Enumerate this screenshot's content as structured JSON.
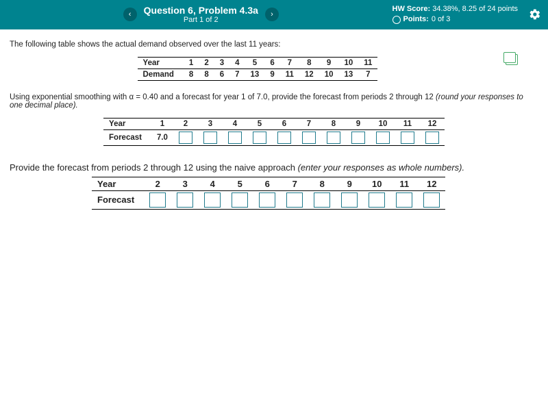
{
  "header": {
    "prev": "‹",
    "next": "›",
    "title": "Question 6, Problem 4.3a",
    "subtitle": "Part 1 of 2",
    "hw_label": "HW Score:",
    "hw_value": "34.38%, 8.25 of 24 points",
    "points_label": "Points:",
    "points_value": "0 of 3"
  },
  "intro": "The following table shows the actual demand observed over the last 11 years:",
  "table1": {
    "row1_label": "Year",
    "row2_label": "Demand",
    "years": [
      "1",
      "2",
      "3",
      "4",
      "5",
      "6",
      "7",
      "8",
      "9",
      "10",
      "11"
    ],
    "demand": [
      "8",
      "8",
      "6",
      "7",
      "13",
      "9",
      "11",
      "12",
      "10",
      "13",
      "7"
    ]
  },
  "prompt2_a": "Using exponential smoothing with α = 0.40 and a forecast for year 1 of 7.0, provide the forecast from periods 2 through 12 ",
  "prompt2_b": "(round your responses to one decimal place).",
  "table2": {
    "row1_label": "Year",
    "row2_label": "Forecast",
    "years": [
      "1",
      "2",
      "3",
      "4",
      "5",
      "6",
      "7",
      "8",
      "9",
      "10",
      "11",
      "12"
    ],
    "first_forecast": "7.0"
  },
  "prompt3_a": "Provide the forecast from periods 2 through 12 using the naive approach ",
  "prompt3_b": "(enter your responses as whole numbers).",
  "table3": {
    "row1_label": "Year",
    "row2_label": "Forecast",
    "years": [
      "2",
      "3",
      "4",
      "5",
      "6",
      "7",
      "8",
      "9",
      "10",
      "11",
      "12"
    ]
  }
}
